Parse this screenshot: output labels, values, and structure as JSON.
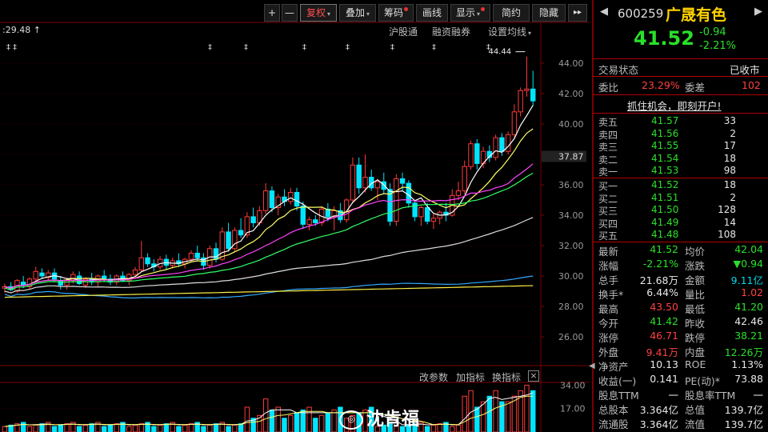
{
  "toolbar": {
    "plus": "+",
    "minus": "—",
    "fuquan": "复权",
    "diejia": "叠加",
    "chouma": "筹码",
    "huaxian": "画线",
    "xianshi": "显示",
    "jianyue": "简约",
    "yincang": "隐藏",
    "more": "▸▸"
  },
  "subbar": {
    "price_marker": ":29.48",
    "hugutong": "沪股通",
    "rongzi": "融资融券",
    "shezhi": "设置均线"
  },
  "chart": {
    "high_label": "44.44",
    "current_tag": "37.87",
    "y_ticks": [
      "44.00",
      "42.00",
      "40.00",
      "38.00",
      "36.00",
      "34.00",
      "32.00",
      "30.00",
      "28.00",
      "26.00"
    ],
    "vol_ticks": [
      "34.00",
      "17.00"
    ],
    "indicator_bar": {
      "gaican": "改参数",
      "jiazhibiao": "加指标",
      "huanzhibiao": "换指标",
      "close": "×"
    },
    "watermark": "沈肯福"
  },
  "chart_data": {
    "type": "candlestick",
    "ylim": [
      25,
      45
    ],
    "y_ticks": [
      26,
      28,
      30,
      32,
      34,
      36,
      38,
      40,
      42,
      44
    ],
    "candles": [
      [
        29.2,
        29.5,
        28.9,
        29.3
      ],
      [
        29.3,
        29.6,
        29.0,
        29.1
      ],
      [
        29.0,
        29.8,
        28.9,
        29.7
      ],
      [
        29.6,
        30.0,
        29.2,
        29.4
      ],
      [
        29.3,
        29.9,
        29.1,
        29.8
      ],
      [
        29.8,
        30.6,
        29.6,
        30.3
      ],
      [
        30.2,
        30.5,
        29.8,
        30.0
      ],
      [
        29.9,
        30.4,
        29.7,
        30.2
      ],
      [
        30.2,
        30.5,
        29.6,
        29.8
      ],
      [
        29.7,
        30.0,
        29.1,
        29.4
      ],
      [
        29.4,
        29.9,
        29.1,
        29.7
      ],
      [
        29.7,
        30.3,
        29.5,
        30.1
      ],
      [
        30.0,
        30.3,
        29.4,
        29.5
      ],
      [
        29.4,
        29.9,
        29.2,
        29.8
      ],
      [
        29.8,
        30.2,
        29.4,
        29.6
      ],
      [
        29.6,
        30.1,
        29.3,
        30.0
      ],
      [
        30.0,
        30.4,
        29.6,
        29.8
      ],
      [
        29.8,
        30.1,
        29.4,
        29.6
      ],
      [
        29.6,
        30.1,
        29.4,
        30.0
      ],
      [
        30.0,
        30.3,
        29.6,
        29.7
      ],
      [
        29.7,
        30.2,
        29.4,
        30.1
      ],
      [
        30.1,
        30.6,
        29.9,
        30.4
      ],
      [
        30.4,
        32.3,
        30.3,
        31.2
      ],
      [
        31.2,
        31.5,
        30.6,
        30.8
      ],
      [
        30.8,
        31.1,
        30.3,
        30.6
      ],
      [
        30.6,
        31.3,
        30.4,
        31.1
      ],
      [
        31.1,
        31.4,
        30.4,
        30.7
      ],
      [
        30.7,
        31.2,
        30.5,
        31.0
      ],
      [
        31.0,
        31.5,
        30.6,
        30.8
      ],
      [
        30.8,
        31.2,
        30.5,
        31.1
      ],
      [
        31.1,
        31.7,
        30.9,
        31.5
      ],
      [
        31.5,
        32.0,
        31.0,
        31.2
      ],
      [
        31.2,
        31.5,
        30.4,
        30.7
      ],
      [
        30.7,
        32.0,
        30.5,
        31.8
      ],
      [
        31.8,
        32.2,
        30.9,
        31.1
      ],
      [
        31.1,
        33.2,
        31.0,
        32.9
      ],
      [
        32.9,
        33.5,
        31.6,
        31.8
      ],
      [
        31.8,
        33.2,
        31.6,
        33.0
      ],
      [
        33.0,
        33.8,
        32.5,
        32.7
      ],
      [
        32.7,
        34.2,
        32.5,
        33.9
      ],
      [
        33.9,
        34.5,
        33.2,
        33.5
      ],
      [
        33.5,
        34.6,
        33.3,
        34.3
      ],
      [
        34.3,
        36.1,
        34.1,
        35.6
      ],
      [
        35.6,
        35.9,
        34.2,
        34.5
      ],
      [
        34.5,
        35.4,
        34.0,
        35.2
      ],
      [
        35.2,
        35.7,
        34.6,
        34.9
      ],
      [
        34.9,
        35.8,
        34.7,
        35.5
      ],
      [
        35.5,
        35.8,
        34.3,
        34.6
      ],
      [
        34.6,
        34.9,
        33.1,
        33.4
      ],
      [
        33.4,
        33.9,
        33.0,
        33.7
      ],
      [
        33.7,
        34.0,
        33.3,
        33.5
      ],
      [
        33.5,
        34.6,
        33.3,
        34.4
      ],
      [
        34.4,
        34.8,
        33.6,
        33.9
      ],
      [
        33.9,
        34.6,
        33.0,
        34.3
      ],
      [
        34.3,
        34.8,
        33.5,
        33.7
      ],
      [
        33.7,
        35.1,
        33.5,
        35.0
      ],
      [
        35.0,
        37.8,
        34.8,
        37.3
      ],
      [
        37.3,
        37.8,
        35.4,
        35.8
      ],
      [
        35.8,
        38.0,
        35.5,
        36.5
      ],
      [
        36.5,
        37.0,
        35.6,
        35.8
      ],
      [
        35.8,
        36.4,
        35.0,
        36.2
      ],
      [
        36.2,
        36.8,
        35.4,
        35.7
      ],
      [
        35.7,
        36.1,
        33.3,
        33.6
      ],
      [
        33.6,
        36.7,
        33.3,
        36.4
      ],
      [
        36.4,
        36.8,
        35.6,
        36.1
      ],
      [
        36.1,
        36.3,
        34.5,
        34.8
      ],
      [
        34.8,
        35.0,
        33.6,
        33.9
      ],
      [
        33.9,
        34.6,
        33.3,
        34.5
      ],
      [
        34.5,
        34.8,
        33.4,
        33.6
      ],
      [
        33.6,
        34.1,
        33.1,
        33.8
      ],
      [
        33.8,
        34.3,
        33.4,
        34.2
      ],
      [
        34.2,
        34.8,
        33.6,
        34.0
      ],
      [
        34.0,
        35.7,
        33.9,
        35.3
      ],
      [
        35.3,
        36.2,
        35.0,
        35.6
      ],
      [
        35.6,
        37.6,
        35.4,
        37.2
      ],
      [
        37.2,
        38.9,
        37.0,
        38.7
      ],
      [
        38.7,
        39.0,
        37.0,
        37.4
      ],
      [
        37.4,
        38.5,
        37.1,
        38.2
      ],
      [
        38.2,
        38.6,
        37.5,
        37.8
      ],
      [
        37.8,
        39.3,
        37.6,
        39.1
      ],
      [
        39.1,
        39.4,
        37.9,
        38.2
      ],
      [
        38.2,
        39.5,
        38.0,
        39.3
      ],
      [
        39.3,
        41.3,
        39.1,
        40.8
      ],
      [
        40.8,
        42.4,
        40.5,
        42.2
      ],
      [
        42.2,
        44.44,
        41.8,
        42.3
      ],
      [
        42.3,
        43.5,
        41.2,
        41.52
      ]
    ],
    "volume_ylim": [
      0,
      36
    ]
  },
  "stock": {
    "code": "600259",
    "name": "广晟有色",
    "price": "41.52",
    "change": "-0.94",
    "change_pct": "-2.21%",
    "trade_state_label": "交易状态",
    "trade_state": "已收市",
    "weibi_label": "委比",
    "weibi": "23.29%",
    "weicha_label": "委差",
    "weicha": "102",
    "promo": "抓住机会，即刻开户!"
  },
  "orderbook": {
    "asks": [
      {
        "label": "卖五",
        "price": "41.57",
        "vol": "33"
      },
      {
        "label": "卖四",
        "price": "41.56",
        "vol": "2"
      },
      {
        "label": "卖三",
        "price": "41.55",
        "vol": "17"
      },
      {
        "label": "卖二",
        "price": "41.54",
        "vol": "18"
      },
      {
        "label": "卖一",
        "price": "41.53",
        "vol": "98"
      }
    ],
    "bids": [
      {
        "label": "买一",
        "price": "41.52",
        "vol": "18"
      },
      {
        "label": "买二",
        "price": "41.51",
        "vol": "2"
      },
      {
        "label": "买三",
        "price": "41.50",
        "vol": "128"
      },
      {
        "label": "买四",
        "price": "41.49",
        "vol": "14"
      },
      {
        "label": "买五",
        "price": "41.48",
        "vol": "108"
      }
    ]
  },
  "stats": [
    {
      "l1": "最新",
      "v1": "41.52",
      "c1": "green",
      "l2": "均价",
      "v2": "42.04",
      "c2": "green"
    },
    {
      "l1": "涨幅",
      "v1": "-2.21%",
      "c1": "green",
      "l2": "涨跌",
      "v2": "▼0.94",
      "c2": "green"
    },
    {
      "l1": "总手",
      "v1": "21.68万",
      "c1": "white",
      "l2": "金额",
      "v2": "9.11亿",
      "c2": "cyan"
    },
    {
      "l1": "换手*",
      "v1": "6.44%",
      "c1": "white",
      "l2": "量比",
      "v2": "1.02",
      "c2": "red"
    },
    {
      "l1": "最高",
      "v1": "43.50",
      "c1": "red",
      "l2": "最低",
      "v2": "41.20",
      "c2": "green"
    },
    {
      "l1": "今开",
      "v1": "41.42",
      "c1": "green",
      "l2": "昨收",
      "v2": "42.46",
      "c2": "white"
    },
    {
      "l1": "涨停",
      "v1": "46.71",
      "c1": "red",
      "l2": "跌停",
      "v2": "38.21",
      "c2": "green"
    },
    {
      "l1": "外盘",
      "v1": "9.41万",
      "c1": "red",
      "l2": "内盘",
      "v2": "12.26万",
      "c2": "green"
    },
    {
      "l1": "净资产",
      "v1": "10.13",
      "c1": "white",
      "l2": "ROE",
      "v2": "1.13%",
      "c2": "white"
    },
    {
      "l1": "收益(一)",
      "v1": "0.141",
      "c1": "white",
      "l2": "PE(动)*",
      "v2": "73.88",
      "c2": "white"
    },
    {
      "l1": "股息TTM",
      "v1": "一",
      "c1": "white",
      "l2": "股息率TTM",
      "v2": "一",
      "c2": "white"
    },
    {
      "l1": "总股本",
      "v1": "3.364亿",
      "c1": "white",
      "l2": "总值",
      "v2": "139.7亿",
      "c2": "white"
    },
    {
      "l1": "流通股",
      "v1": "3.364亿",
      "c1": "white",
      "l2": "流值",
      "v2": "139.7亿",
      "c2": "white"
    }
  ]
}
